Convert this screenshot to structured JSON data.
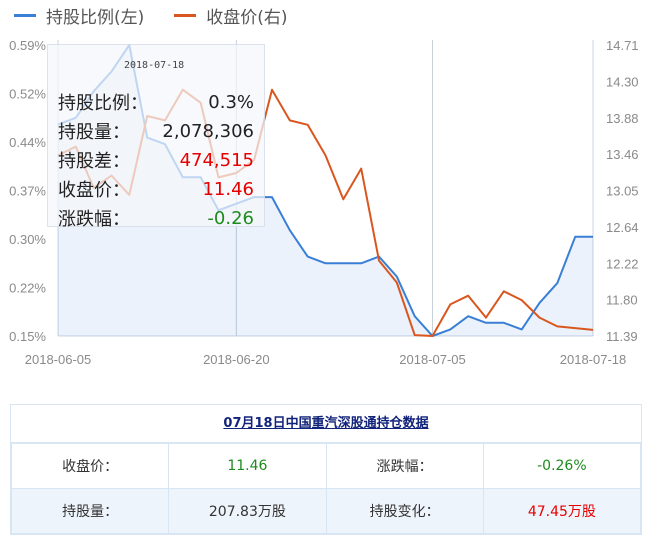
{
  "legend": [
    {
      "label": "持股比例(左)",
      "color": "#3a7fd6"
    },
    {
      "label": "收盘价(右)",
      "color": "#d9571f"
    }
  ],
  "chart_data": {
    "type": "line",
    "x": [
      "2018-06-05",
      "2018-06-06",
      "2018-06-07",
      "2018-06-08",
      "2018-06-11",
      "2018-06-12",
      "2018-06-13",
      "2018-06-14",
      "2018-06-15",
      "2018-06-19",
      "2018-06-20",
      "2018-06-21",
      "2018-06-22",
      "2018-06-25",
      "2018-06-26",
      "2018-06-27",
      "2018-06-28",
      "2018-06-29",
      "2018-07-02",
      "2018-07-03",
      "2018-07-04",
      "2018-07-05",
      "2018-07-06",
      "2018-07-09",
      "2018-07-10",
      "2018-07-11",
      "2018-07-12",
      "2018-07-13",
      "2018-07-16",
      "2018-07-17",
      "2018-07-18"
    ],
    "x_tick_labels": [
      "2018-06-05",
      "2018-06-20",
      "2018-07-05",
      "2018-07-18"
    ],
    "series": [
      {
        "name": "持股比例(左)",
        "axis": "left",
        "color": "#3a7fd6",
        "values": [
          0.47,
          0.48,
          0.52,
          0.55,
          0.59,
          0.45,
          0.44,
          0.39,
          0.39,
          0.34,
          0.35,
          0.36,
          0.36,
          0.31,
          0.27,
          0.26,
          0.26,
          0.26,
          0.27,
          0.24,
          0.18,
          0.15,
          0.16,
          0.18,
          0.17,
          0.17,
          0.16,
          0.2,
          0.23,
          0.3,
          0.3
        ]
      },
      {
        "name": "收盘价(右)",
        "axis": "right",
        "color": "#d9571f",
        "values": [
          13.45,
          13.55,
          13.08,
          13.22,
          13.0,
          13.9,
          13.85,
          14.2,
          14.05,
          13.2,
          13.25,
          13.4,
          14.2,
          13.85,
          13.8,
          13.45,
          12.95,
          13.3,
          12.25,
          12.0,
          11.4,
          11.39,
          11.75,
          11.85,
          11.6,
          11.9,
          11.8,
          11.6,
          11.5,
          11.48,
          11.46
        ]
      }
    ],
    "y_left": {
      "ticks": [
        "0.59%",
        "0.52%",
        "0.44%",
        "0.37%",
        "0.30%",
        "0.22%",
        "0.15%"
      ],
      "ylim": [
        0.15,
        0.59
      ]
    },
    "y_right": {
      "ticks": [
        "14.71",
        "14.30",
        "13.88",
        "13.46",
        "13.05",
        "12.64",
        "12.22",
        "11.80",
        "11.39"
      ],
      "ylim": [
        11.39,
        14.71
      ]
    },
    "vertical_reference_lines_at": [
      "2018-06-20",
      "2018-07-05"
    ],
    "grid": "vertical lines at x ticks"
  },
  "tooltip": {
    "date": "2018-07-18",
    "rows": [
      {
        "label": "持股比例：",
        "value": "0.3%",
        "tone": "normal"
      },
      {
        "label": "持股量：",
        "value": "2,078,306",
        "tone": "normal"
      },
      {
        "label": "持股差：",
        "value": "474,515",
        "tone": "red"
      },
      {
        "label": "收盘价：",
        "value": "11.46",
        "tone": "red"
      },
      {
        "label": "涨跌幅：",
        "value": "-0.26",
        "tone": "green"
      }
    ]
  },
  "table": {
    "title": "07月18日中国重汽深股通持仓数据",
    "rows": [
      {
        "label1": "收盘价：",
        "value1": "11.46",
        "label2": "涨跌幅：",
        "value2": "-0.26%"
      },
      {
        "label1": "持股量：",
        "value1": "207.83万股",
        "label2": "持股变化：",
        "value2": "47.45万股"
      }
    ]
  }
}
